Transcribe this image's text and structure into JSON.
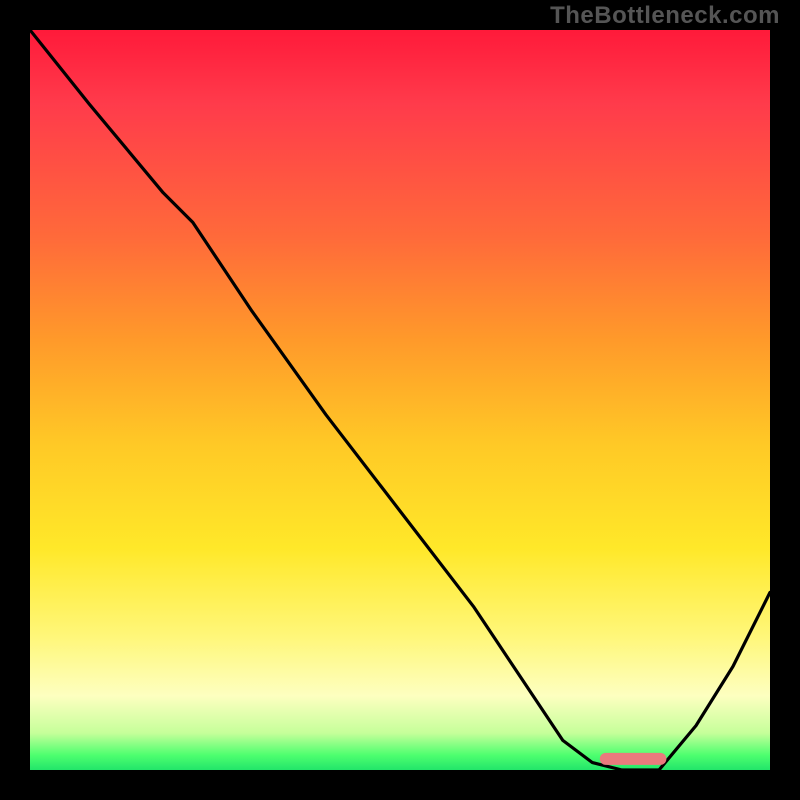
{
  "watermark": "TheBottleneck.com",
  "chart_data": {
    "type": "line",
    "title": "",
    "xlabel": "",
    "ylabel": "",
    "xlim": [
      0,
      100
    ],
    "ylim": [
      0,
      100
    ],
    "grid": false,
    "legend": false,
    "series": [
      {
        "name": "bottleneck-curve",
        "x": [
          0,
          8,
          18,
          22,
          30,
          40,
          50,
          60,
          68,
          72,
          76,
          80,
          85,
          90,
          95,
          100
        ],
        "values": [
          100,
          90,
          78,
          74,
          62,
          48,
          35,
          22,
          10,
          4,
          1,
          0,
          0,
          6,
          14,
          24
        ]
      }
    ],
    "marker": {
      "name": "optimal-range",
      "x_start": 77,
      "x_end": 86,
      "y": 1.5,
      "color": "#e97a7d"
    },
    "gradient_stops": [
      {
        "pos": 0,
        "color": "#ff1a3a"
      },
      {
        "pos": 28,
        "color": "#ff6a3a"
      },
      {
        "pos": 56,
        "color": "#ffc926"
      },
      {
        "pos": 82,
        "color": "#fff77a"
      },
      {
        "pos": 100,
        "color": "#22e56a"
      }
    ]
  }
}
